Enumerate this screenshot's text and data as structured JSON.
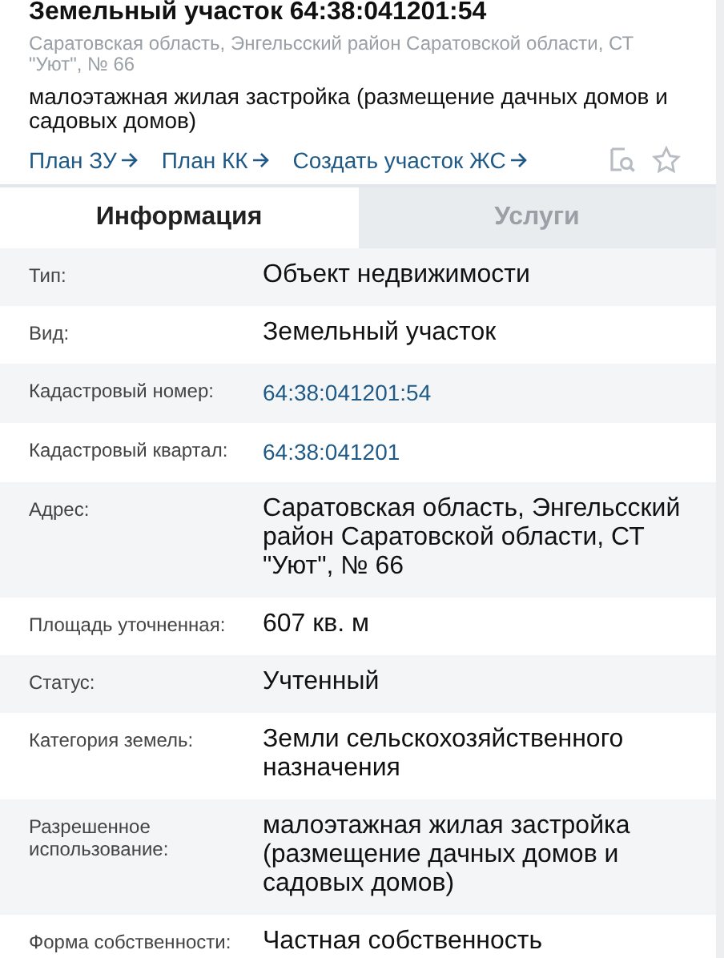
{
  "header": {
    "title": "Земельный участок 64:38:041201:54",
    "address": "Саратовская область, Энгельсский район Саратовской области, СТ \"Уют\", № 66",
    "description": "малоэтажная жилая застройка (размещение дачных домов и садовых домов)",
    "links": [
      "План ЗУ",
      "План КК",
      "Создать участок ЖС"
    ]
  },
  "tabs": [
    {
      "label": "Информация",
      "selected": true
    },
    {
      "label": "Услуги",
      "selected": false
    }
  ],
  "rows": [
    {
      "label": "Тип:",
      "value": "Объект недвижимости",
      "kind": "text"
    },
    {
      "label": "Вид:",
      "value": "Земельный участок",
      "kind": "text"
    },
    {
      "label": "Кадастровый номер:",
      "value": "64:38:041201:54",
      "kind": "link"
    },
    {
      "label": "Кадастровый квартал:",
      "value": "64:38:041201",
      "kind": "link"
    },
    {
      "label": "Адрес:",
      "value": "Саратовская область, Энгельсский район Саратовской области, СТ \"Уют\", № 66",
      "kind": "text"
    },
    {
      "label": "Площадь уточненная:",
      "value": "607 кв. м",
      "kind": "text"
    },
    {
      "label": "Статус:",
      "value": "Учтенный",
      "kind": "text"
    },
    {
      "label": "Категория земель:",
      "value": "Земли сельскохозяйственного назначения",
      "kind": "text"
    },
    {
      "label": "Разрешенное использование:",
      "value": "малоэтажная жилая застройка (размещение дачных домов и садовых домов)",
      "kind": "text"
    },
    {
      "label": "Форма собственности:",
      "value": "Частная собственность",
      "kind": "text"
    }
  ]
}
